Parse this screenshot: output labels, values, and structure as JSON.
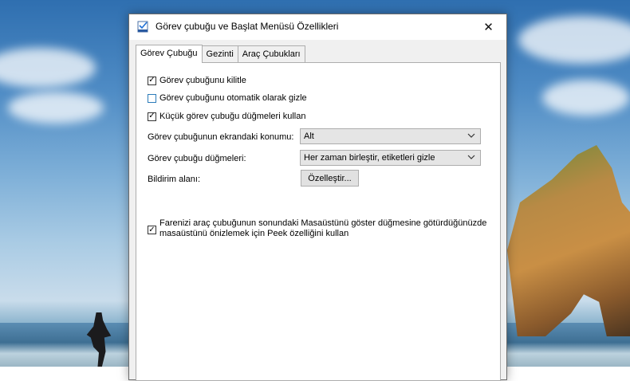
{
  "window": {
    "title": "Görev çubuğu ve Başlat Menüsü Özellikleri",
    "close_glyph": "✕"
  },
  "tabs": [
    {
      "label": "Görev Çubuğu",
      "active": true
    },
    {
      "label": "Gezinti",
      "active": false
    },
    {
      "label": "Araç Çubukları",
      "active": false
    }
  ],
  "options": {
    "lock_taskbar": {
      "label": "Görev çubuğunu kilitle",
      "checked": true
    },
    "auto_hide": {
      "label": "Görev çubuğunu otomatik olarak gizle",
      "checked": false
    },
    "small_buttons": {
      "label": "Küçük görev çubuğu düğmeleri kullan",
      "checked": true
    },
    "peek": {
      "line1": "Farenizi araç çubuğunun sonundaki Masaüstünü göster düğmesine götürdüğünüzde",
      "line2": "masaüstünü önizlemek için Peek özelliğini kullan",
      "checked": true
    }
  },
  "location": {
    "label": "Görev çubuğunun ekrandaki konumu:",
    "value": "Alt"
  },
  "buttons_combine": {
    "label": "Görev çubuğu düğmeleri:",
    "value": "Her zaman birleştir, etiketleri gizle"
  },
  "notification": {
    "label": "Bildirim alanı:",
    "button": "Özelleştir..."
  },
  "check_glyph": "✓"
}
